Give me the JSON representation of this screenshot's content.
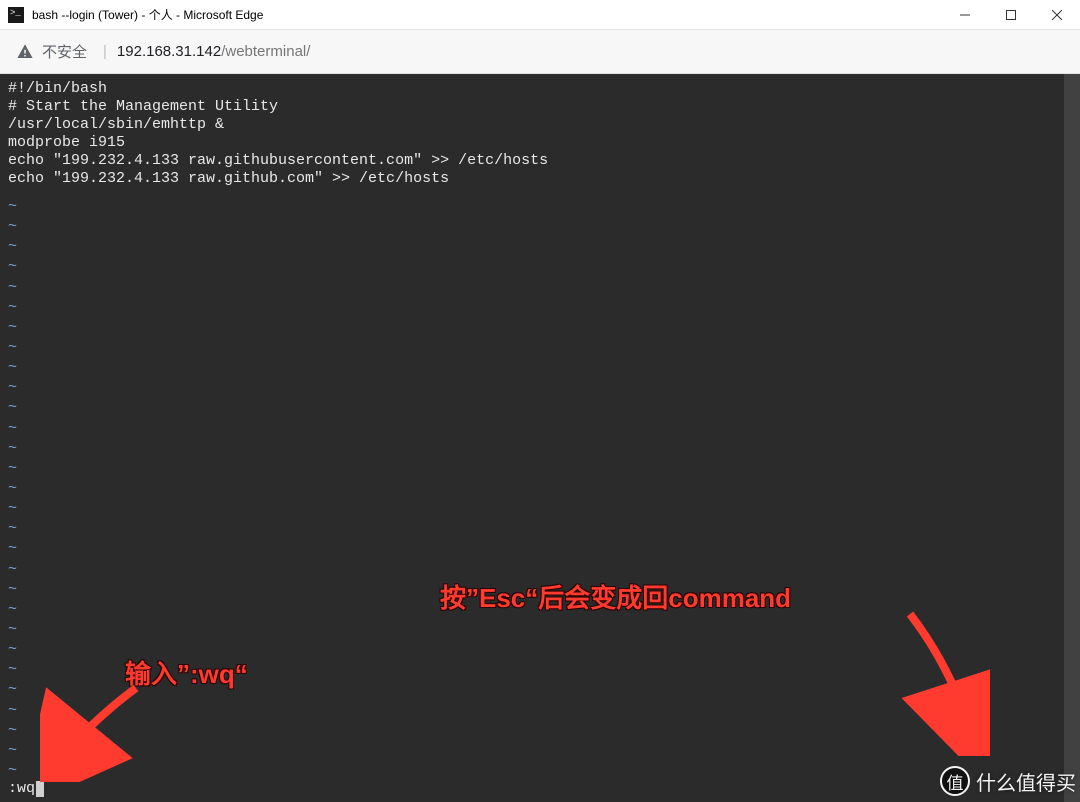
{
  "window": {
    "title": "bash --login (Tower) - 个人 - Microsoft Edge"
  },
  "addressbar": {
    "insecure_label": "不安全",
    "separator": "|",
    "host": "192.168.31.142",
    "path": "/webterminal/"
  },
  "terminal": {
    "file_lines": [
      "#!/bin/bash",
      "# Start the Management Utility",
      "/usr/local/sbin/emhttp &",
      "modprobe i915",
      "echo \"199.232.4.133 raw.githubusercontent.com\" >> /etc/hosts",
      "echo \"199.232.4.133 raw.github.com\" >> /etc/hosts"
    ],
    "tilde_char": "~",
    "tilde_count": 29,
    "command_line": ":wq"
  },
  "annotations": {
    "top_text": "按”Esc“后会变成回command",
    "bottom_text": "输入”:wq“"
  },
  "watermark": {
    "badge_char": "值",
    "text": "什么值得买"
  }
}
